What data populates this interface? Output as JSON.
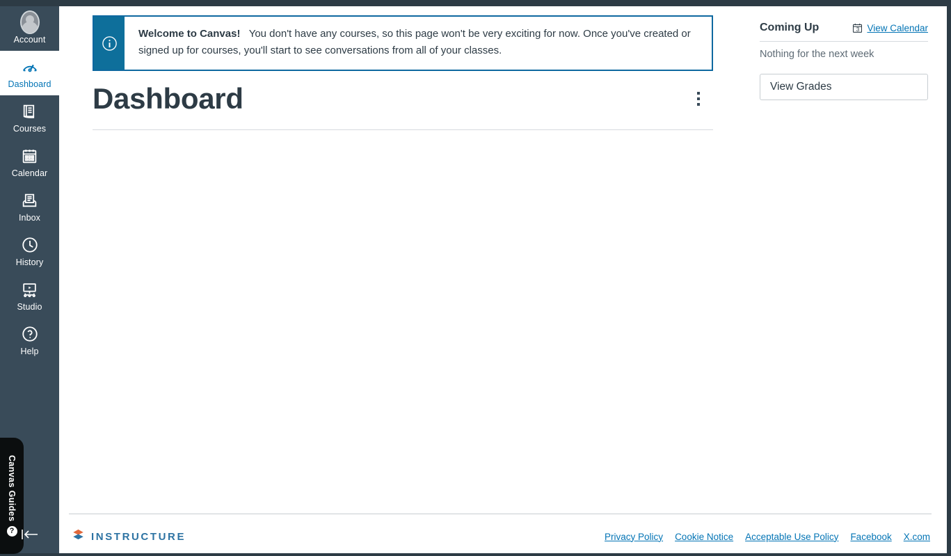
{
  "globalnav": {
    "items": [
      {
        "label": "Account",
        "icon": "avatar-icon",
        "active": false
      },
      {
        "label": "Dashboard",
        "icon": "dashboard-gauge-icon",
        "active": true
      },
      {
        "label": "Courses",
        "icon": "courses-book-icon",
        "active": false
      },
      {
        "label": "Calendar",
        "icon": "calendar-icon",
        "active": false
      },
      {
        "label": "Inbox",
        "icon": "inbox-tray-icon",
        "active": false
      },
      {
        "label": "History",
        "icon": "history-clock-icon",
        "active": false
      },
      {
        "label": "Studio",
        "icon": "studio-screen-icon",
        "active": false
      },
      {
        "label": "Help",
        "icon": "help-question-icon",
        "active": false
      }
    ],
    "guides_tab": {
      "label": "Canvas Guides",
      "icon_glyph": "?"
    },
    "collapse": {
      "icon": "collapse-arrow-icon"
    }
  },
  "alert": {
    "icon": "info-icon",
    "strong_text": "Welcome to Canvas!",
    "body_text": "You don't have any courses, so this page won't be very exciting for now. Once you've created or signed up for courses, you'll start to see conversations from all of your classes.",
    "accent_color": "#0E6F9B",
    "border_color": "#0E68A0"
  },
  "main": {
    "page_title": "Dashboard",
    "options_menu": {
      "icon": "kebab-menu-icon",
      "label": "Dashboard Options"
    }
  },
  "rail": {
    "title": "Coming Up",
    "view_calendar": {
      "label": "View Calendar",
      "icon": "calendar-small-icon",
      "icon_day": "3"
    },
    "empty_text": "Nothing for the next week",
    "view_grades_label": "View Grades"
  },
  "footer": {
    "brand_name": "INSTRUCTURE",
    "links": [
      {
        "label": "Privacy Policy"
      },
      {
        "label": "Cookie Notice"
      },
      {
        "label": "Acceptable Use Policy"
      },
      {
        "label": "Facebook"
      },
      {
        "label": "X.com"
      }
    ]
  },
  "colors": {
    "nav_bg": "#394B59",
    "chrome": "#2D3B45",
    "link": "#0374B5",
    "brand_blue": "#2D73A3",
    "brand_orange": "#E1683B"
  }
}
